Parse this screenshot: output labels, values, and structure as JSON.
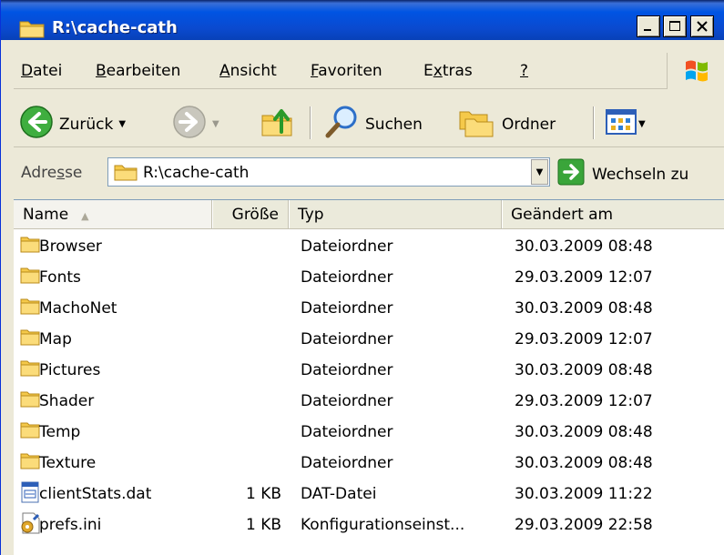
{
  "window": {
    "title": "R:\\cache-cath"
  },
  "menu": [
    {
      "label": "Datei",
      "accel": "D",
      "rest": "atei"
    },
    {
      "label": "Bearbeiten",
      "accel": "B",
      "rest": "earbeiten"
    },
    {
      "label": "Ansicht",
      "accel": "A",
      "rest": "nsicht"
    },
    {
      "label": "Favoriten",
      "accel": "F",
      "rest": "avoriten"
    },
    {
      "label": "Extras",
      "pre": "E",
      "accel": "x",
      "rest": "tras"
    },
    {
      "label": "?",
      "accel": "?",
      "rest": ""
    }
  ],
  "toolbar": {
    "back_label": "Zurück",
    "search_label": "Suchen",
    "folders_label": "Ordner"
  },
  "address": {
    "label_pre": "Adre",
    "label_accel": "s",
    "label_post": "se",
    "value": "R:\\cache-cath",
    "go_label": "Wechseln zu"
  },
  "columns": {
    "name": "Name",
    "size": "Größe",
    "type": "Typ",
    "modified": "Geändert am"
  },
  "files": [
    {
      "name": "Browser",
      "size": "",
      "type": "Dateiordner",
      "modified": "30.03.2009 08:48",
      "icon": "folder-icon"
    },
    {
      "name": "Fonts",
      "size": "",
      "type": "Dateiordner",
      "modified": "29.03.2009 12:07",
      "icon": "folder-icon"
    },
    {
      "name": "MachoNet",
      "size": "",
      "type": "Dateiordner",
      "modified": "30.03.2009 08:48",
      "icon": "folder-icon"
    },
    {
      "name": "Map",
      "size": "",
      "type": "Dateiordner",
      "modified": "29.03.2009 12:07",
      "icon": "folder-icon"
    },
    {
      "name": "Pictures",
      "size": "",
      "type": "Dateiordner",
      "modified": "30.03.2009 08:48",
      "icon": "folder-icon"
    },
    {
      "name": "Shader",
      "size": "",
      "type": "Dateiordner",
      "modified": "29.03.2009 12:07",
      "icon": "folder-icon"
    },
    {
      "name": "Temp",
      "size": "",
      "type": "Dateiordner",
      "modified": "30.03.2009 08:48",
      "icon": "folder-icon"
    },
    {
      "name": "Texture",
      "size": "",
      "type": "Dateiordner",
      "modified": "30.03.2009 08:48",
      "icon": "folder-icon"
    },
    {
      "name": "clientStats.dat",
      "size": "1 KB",
      "type": "DAT-Datei",
      "modified": "30.03.2009 11:22",
      "icon": "dat-file-icon"
    },
    {
      "name": "prefs.ini",
      "size": "1 KB",
      "type": "Konfigurationseinst...",
      "modified": "29.03.2009 22:58",
      "icon": "ini-file-icon"
    }
  ]
}
